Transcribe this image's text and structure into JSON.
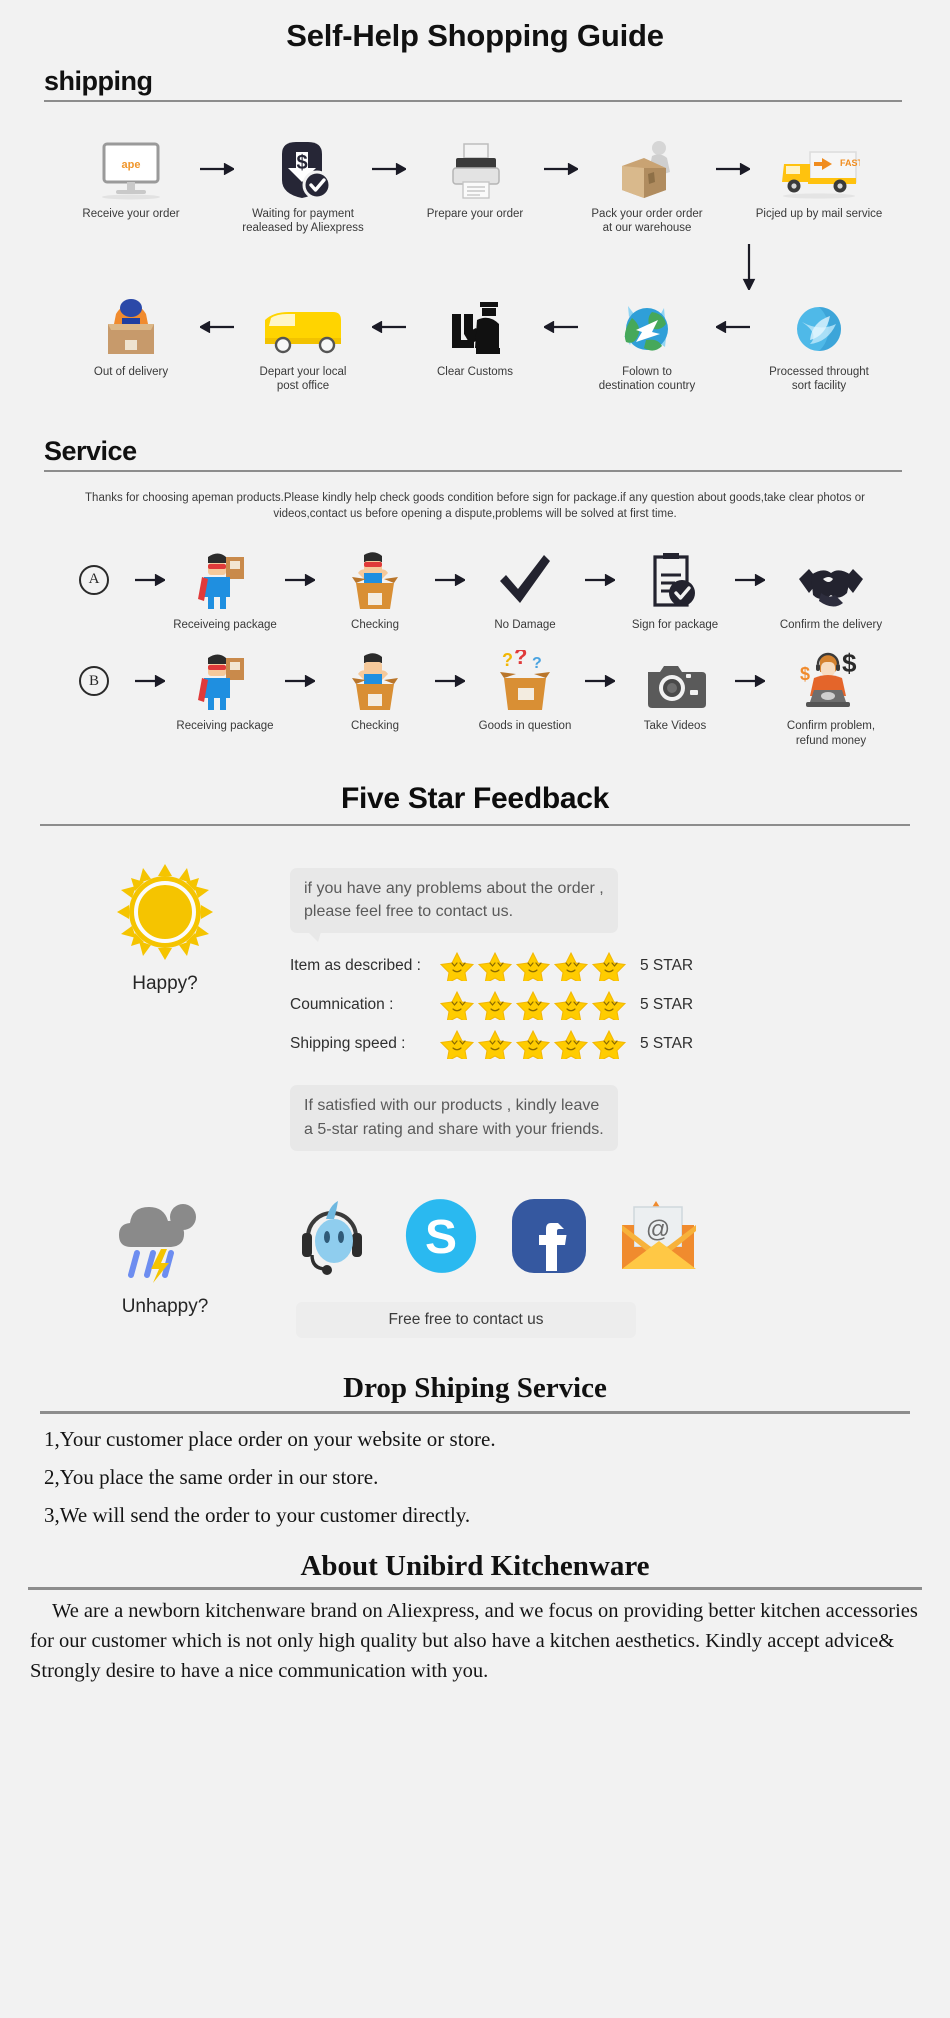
{
  "page": {
    "background_color": "#f2f2f2",
    "main_title": "Self-Help Shopping Guide"
  },
  "shipping": {
    "heading": "shipping",
    "row1": [
      {
        "icon": "monitor-apeman-icon",
        "caption": "Receive your order"
      },
      {
        "icon": "payment-shield-dollar-icon",
        "caption": "Waiting for payment\nrealeased by Aliexpress"
      },
      {
        "icon": "printer-icon",
        "caption": "Prepare your order"
      },
      {
        "icon": "worker-packing-box-icon",
        "caption": "Pack your order order\nat our warehouse"
      },
      {
        "icon": "delivery-truck-fast-icon",
        "caption": "Picjed up by mail service"
      }
    ],
    "row2": [
      {
        "icon": "delivery-man-box-icon",
        "caption": "Out of delivery"
      },
      {
        "icon": "yellow-van-icon",
        "caption": "Depart your local\npost office"
      },
      {
        "icon": "customs-officer-icon",
        "caption": "Clear Customs"
      },
      {
        "icon": "globe-airplane-icon",
        "caption": "Folown to\ndestination country"
      },
      {
        "icon": "blue-globe-sort-icon",
        "caption": "Processed throught\nsort facility"
      }
    ],
    "arrow_right": "arrow-right-icon",
    "arrow_left": "arrow-left-icon",
    "arrow_down": "arrow-down-icon"
  },
  "service": {
    "heading": "Service",
    "note": "Thanks for choosing apeman products.Please kindly help check goods condition before sign for package.if any question about goods,take clear photos or videos,contact us before opening a dispute,problems will be solved at first time.",
    "rowA": {
      "label": "A",
      "steps": [
        {
          "icon": "hero-with-package-icon",
          "caption": "Receiveing package"
        },
        {
          "icon": "hero-opening-box-icon",
          "caption": "Checking"
        },
        {
          "icon": "checkmark-icon",
          "caption": "No Damage"
        },
        {
          "icon": "signed-document-check-icon",
          "caption": "Sign for package"
        },
        {
          "icon": "handshake-icon",
          "caption": "Confirm the delivery"
        }
      ]
    },
    "rowB": {
      "label": "B",
      "steps": [
        {
          "icon": "hero-with-package-icon",
          "caption": "Receiving package"
        },
        {
          "icon": "hero-opening-box-icon",
          "caption": "Checking"
        },
        {
          "icon": "box-question-marks-icon",
          "caption": "Goods in question"
        },
        {
          "icon": "camera-icon",
          "caption": "Take Videos"
        },
        {
          "icon": "support-agent-refund-icon",
          "caption": "Confirm problem,\nrefund money"
        }
      ]
    }
  },
  "feedback": {
    "heading": "Five Star Feedback",
    "happy_icon": "sun-icon",
    "happy_label": "Happy?",
    "bubble_top": "if you have any problems about the order ,\nplease feel free to contact us.",
    "ratings": [
      {
        "label": "Item as described :",
        "stars": 5,
        "value": "5 STAR"
      },
      {
        "label": "Coumnication :",
        "stars": 5,
        "value": "5 STAR"
      },
      {
        "label": "Shipping speed :",
        "stars": 5,
        "value": "5 STAR"
      }
    ],
    "bubble_bottom": "If satisfied with our products ,  kindly leave\na 5-star rating and share with your friends.",
    "unhappy_icon": "storm-cloud-icon",
    "unhappy_label": "Unhappy?",
    "contact_icons": [
      "headset-support-icon",
      "skype-icon",
      "facebook-icon",
      "email-envelope-icon"
    ],
    "contact_pill": "Free free to contact us",
    "star_color": "#ffcc00",
    "star_border": "#f2b705"
  },
  "dropshipping": {
    "heading": "Drop Shiping Service",
    "lines": [
      "1,Your customer place order on your website or store.",
      "2,You place the same order in our store.",
      "3,We will send the order to your customer directly."
    ]
  },
  "about": {
    "heading": "About Unibird Kitchenware",
    "body": "We are a newborn kitchenware brand on Aliexpress, and we focus on providing better kitchen accessories for our customer which is not only high quality but also have a kitchen aesthetics. Kindly accept advice& Strongly desire to have a nice communication with you."
  }
}
